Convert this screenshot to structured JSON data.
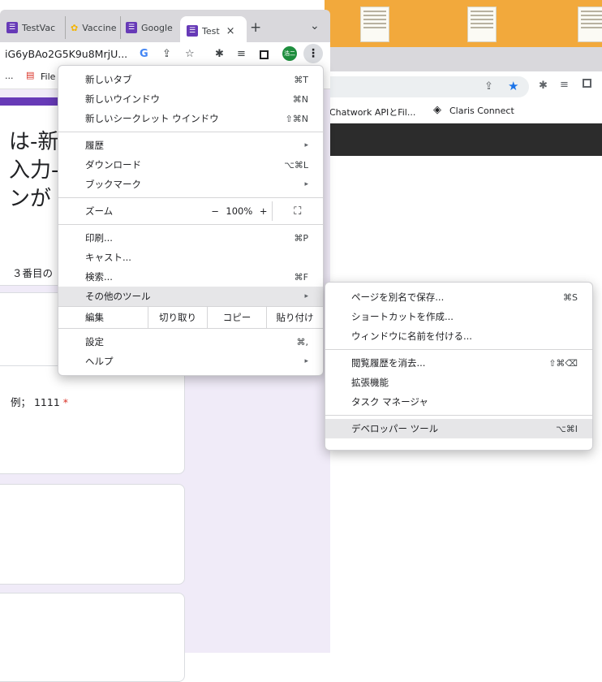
{
  "browser_front": {
    "tabs": [
      {
        "label": "TestVac"
      },
      {
        "label": "Vaccine"
      },
      {
        "label": "Google"
      },
      {
        "label": "Test"
      }
    ],
    "tab_close": "×",
    "new_tab": "+",
    "tab_search": "⌄",
    "url": "iG6yBAo2G5K9u8MrjU...",
    "google_icon": "G",
    "profile_initial": "浩二",
    "kebab": "⋮",
    "bookmarks": [
      {
        "label": "File"
      }
    ],
    "bookmark_ellipsis": "..."
  },
  "browser_back": {
    "bookmarks": [
      {
        "label": "Chatwork APIとFil..."
      },
      {
        "label": "Claris Connect"
      }
    ]
  },
  "form": {
    "heading_lines": [
      "は-新",
      "入力-",
      "ンが"
    ],
    "question3": "３番目の",
    "question_example": "例；  1111",
    "required_mark": "*"
  },
  "main_menu": {
    "items": [
      {
        "label": "新しいタブ",
        "shortcut": "⌘T"
      },
      {
        "label": "新しいウインドウ",
        "shortcut": "⌘N"
      },
      {
        "label": "新しいシークレット ウインドウ",
        "shortcut": "⇧⌘N"
      },
      {
        "label": "履歴",
        "submenu": "▸"
      },
      {
        "label": "ダウンロード",
        "shortcut": "⌥⌘L"
      },
      {
        "label": "ブックマーク",
        "submenu": "▸"
      },
      {
        "label": "印刷...",
        "shortcut": "⌘P"
      },
      {
        "label": "キャスト..."
      },
      {
        "label": "検索...",
        "shortcut": "⌘F"
      },
      {
        "label": "その他のツール",
        "submenu": "▸"
      },
      {
        "label": "設定",
        "shortcut": "⌘,"
      },
      {
        "label": "ヘルプ",
        "submenu": "▸"
      }
    ],
    "zoom": {
      "label": "ズーム",
      "minus": "−",
      "value": "100%",
      "plus": "+",
      "fullscreen": "⛶"
    },
    "edit": {
      "label": "編集",
      "cut": "切り取り",
      "copy": "コピー",
      "paste": "貼り付け"
    }
  },
  "sub_menu": {
    "items": [
      {
        "label": "ページを別名で保存...",
        "shortcut": "⌘S"
      },
      {
        "label": "ショートカットを作成..."
      },
      {
        "label": "ウィンドウに名前を付ける..."
      },
      {
        "label": "閲覧履歴を消去...",
        "shortcut": "⇧⌘⌫"
      },
      {
        "label": "拡張機能"
      },
      {
        "label": "タスク マネージャ"
      },
      {
        "label": "デベロッパー ツール",
        "shortcut": "⌥⌘I"
      }
    ]
  },
  "colors": {
    "forms_purple": "#673ab7",
    "page_bg": "#f0ebf8",
    "back_bg_orange": "#f2a93c",
    "profile_green": "#1e8e3e"
  }
}
